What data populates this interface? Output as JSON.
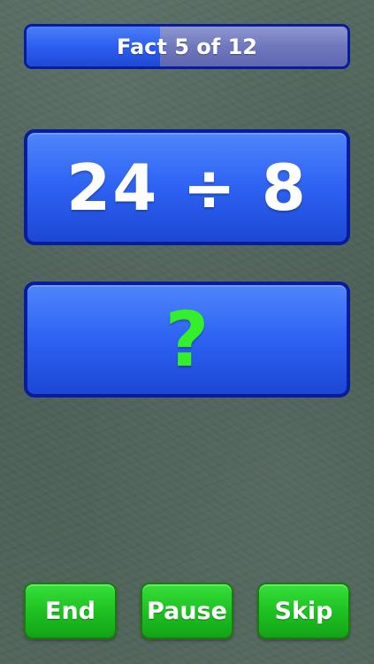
{
  "progress": {
    "label": "Fact 5 of 12",
    "current": 5,
    "total": 12,
    "fraction": 0.4167
  },
  "question": {
    "expression": "24 ÷ 8"
  },
  "answer": {
    "value": "?"
  },
  "buttons": {
    "end_label": "End",
    "pause_label": "Pause",
    "skip_label": "Skip"
  },
  "colors": {
    "card_blue": "#2e63f4",
    "card_border": "#0a1c9e",
    "button_green": "#1fc222",
    "answer_green": "#34f02a",
    "chalkboard": "#4f6359"
  }
}
